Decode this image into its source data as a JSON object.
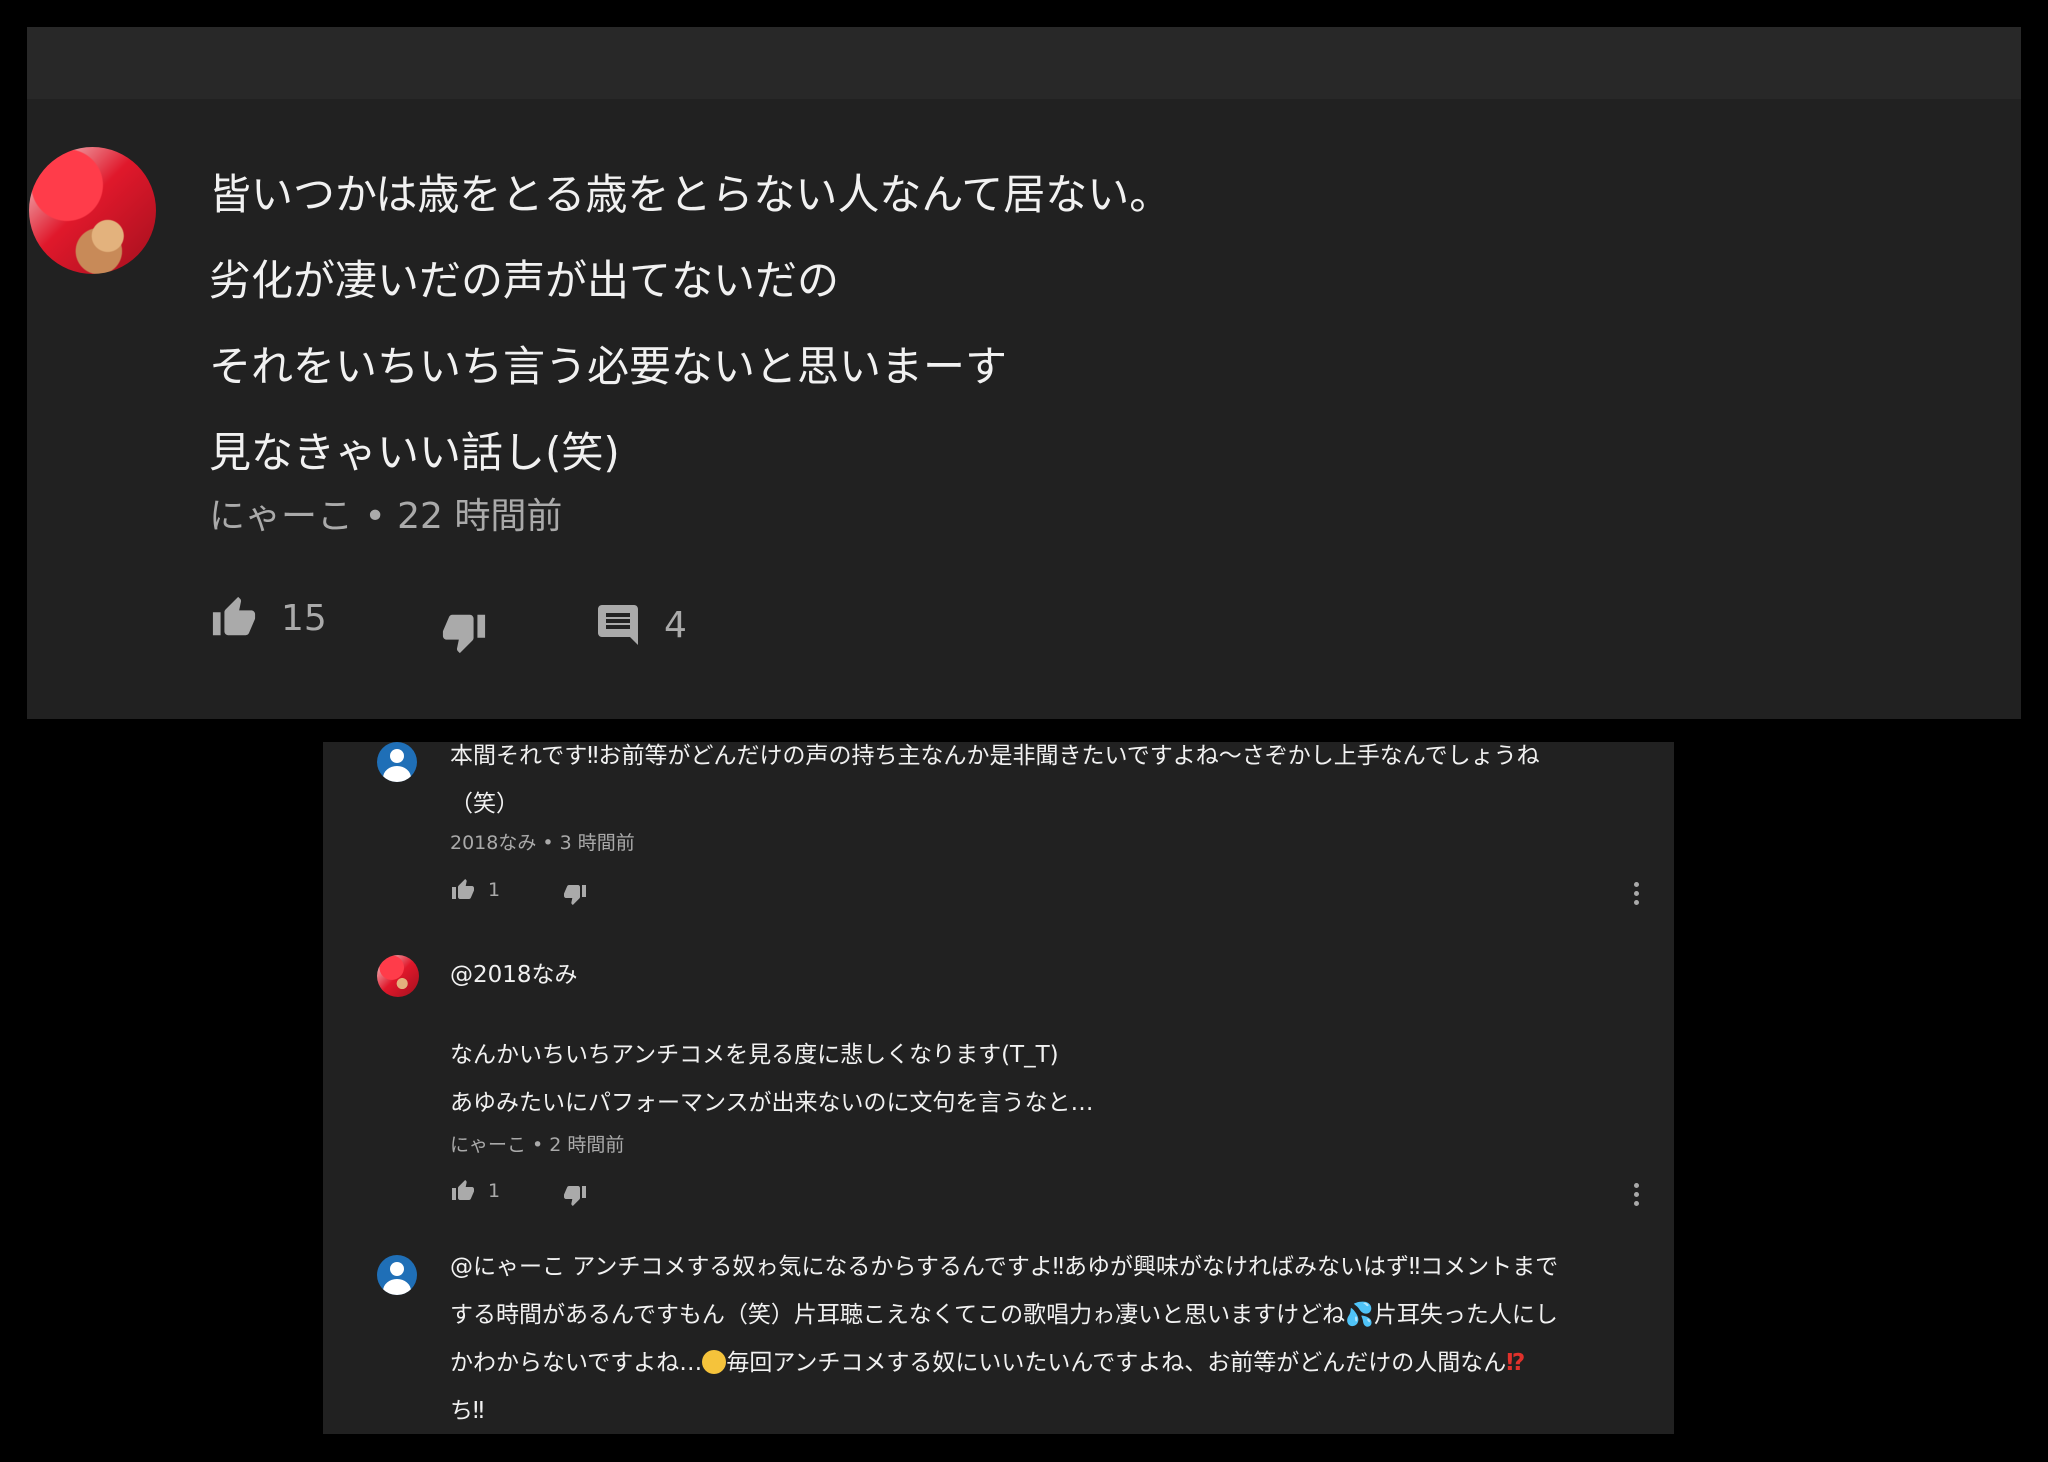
{
  "main_comment": {
    "lines": [
      "皆いつかは歳をとる歳をとらない人なんて居ない。",
      "劣化が凄いだの声が出てないだの",
      "それをいちいち言う必要ないと思いまーす",
      "見なきゃいい話し(笑)"
    ],
    "meta": "にゃーこ • 22 時間前",
    "likes": "15",
    "replies": "4",
    "icons": [
      "like-icon",
      "dislike-icon",
      "reply-icon"
    ]
  },
  "replies": [
    {
      "avatar": "default-avatar",
      "lines": [
        "本間それです‼お前等がどんだけの声の持ち主なんか是非聞きたいですよね〜さぞかし上手なんでしょうね",
        "（笑）"
      ],
      "meta": "2018なみ • 3 時間前",
      "likes": "1"
    },
    {
      "avatar": "photo-avatar",
      "mention": "@2018なみ",
      "lines": [
        "なんかいちいちアンチコメを見る度に悲しくなります(T_T)",
        "あゆみたいにパフォーマンスが出来ないのに文句を言うなと…"
      ],
      "meta": "にゃーこ • 2 時間前",
      "likes": "1"
    },
    {
      "avatar": "default-avatar",
      "line1": "@にゃーこ アンチコメする奴ゎ気になるからするんですよ‼あゆが興味がなければみないはず‼コメントまで",
      "line2": "する時間があるんですもん（笑）片耳聴こえなくてこの歌唱力ゎ凄いと思いますけどね",
      "line2_emoji": "💦",
      "line2_after": "片耳失った人にし",
      "line3": "かわからないですよね…",
      "line3_emoji": "😣",
      "line3_after": "毎回アンチコメする奴にいいたいんですよね、お前等がどんだけの人間なん",
      "line3_end_emoji": "⁉",
      "line4": "ち‼"
    }
  ]
}
